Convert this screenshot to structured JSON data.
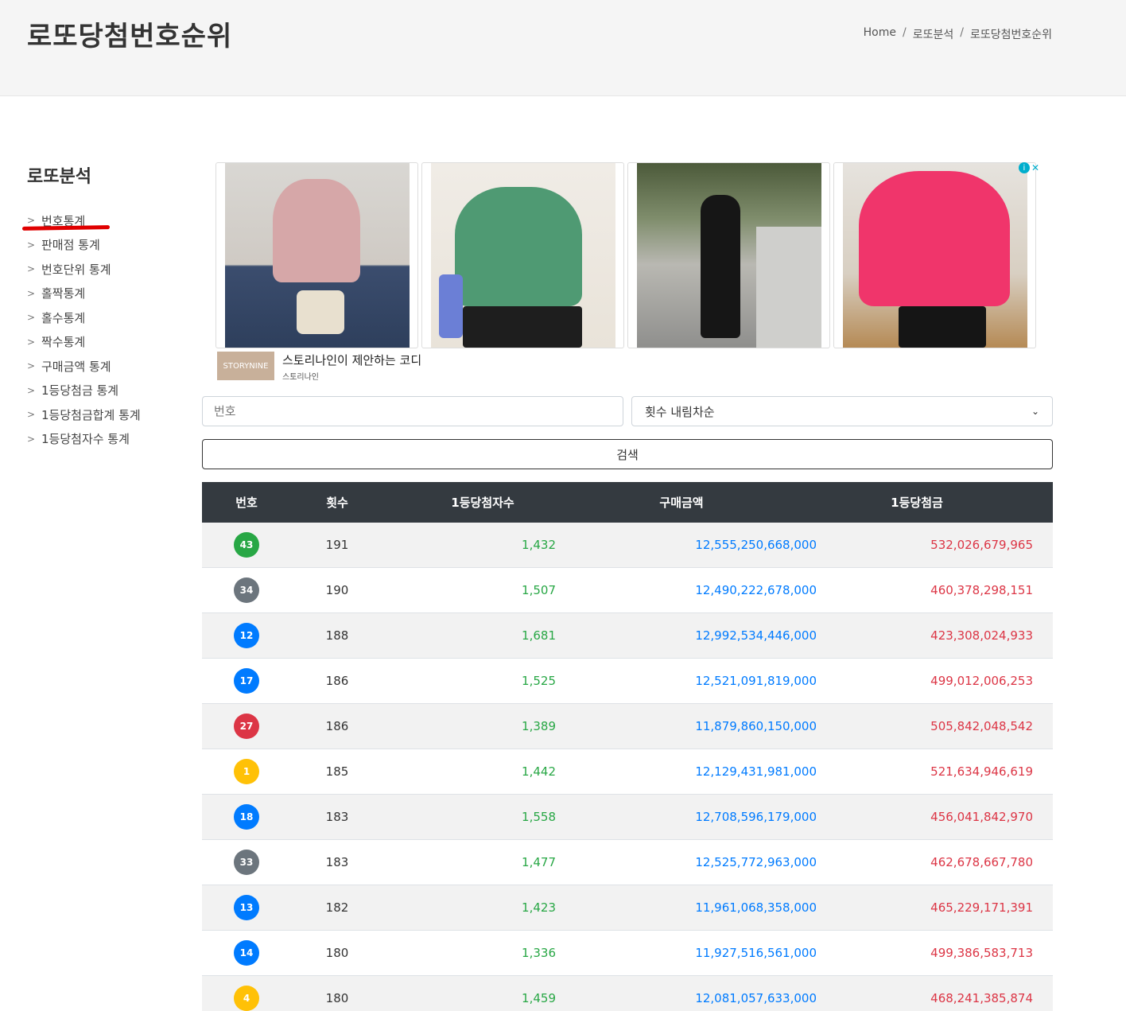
{
  "header": {
    "title": "로또당첨번호순위",
    "breadcrumb": [
      "Home",
      "로또분석",
      "로또당첨번호순위"
    ]
  },
  "sidebar": {
    "title": "로또분석",
    "items": [
      {
        "label": "번호통계",
        "active": true
      },
      {
        "label": "판매점 통계"
      },
      {
        "label": "번호단위 통계"
      },
      {
        "label": "홀짝통계"
      },
      {
        "label": "홀수통계"
      },
      {
        "label": "짝수통계"
      },
      {
        "label": "구매금액 통계"
      },
      {
        "label": "1등당첨금 통계"
      },
      {
        "label": "1등당첨금합계 통계"
      },
      {
        "label": "1등당첨자수 통계"
      }
    ]
  },
  "ad": {
    "title": "스토리나인이 제안하는 코디",
    "advertiser": "스토리나인",
    "logo_text": "STORYNINE"
  },
  "search": {
    "placeholder": "번호",
    "sort_value": "횟수 내림차순",
    "button": "검색"
  },
  "table": {
    "headers": [
      "번호",
      "횟수",
      "1등당첨자수",
      "구매금액",
      "1등당첨금"
    ],
    "rows": [
      {
        "num": "43",
        "color": "#28a745",
        "count": "191",
        "winners": "1,432",
        "purchase": "12,555,250,668,000",
        "prize": "532,026,679,965"
      },
      {
        "num": "34",
        "color": "#6c757d",
        "count": "190",
        "winners": "1,507",
        "purchase": "12,490,222,678,000",
        "prize": "460,378,298,151"
      },
      {
        "num": "12",
        "color": "#007bff",
        "count": "188",
        "winners": "1,681",
        "purchase": "12,992,534,446,000",
        "prize": "423,308,024,933"
      },
      {
        "num": "17",
        "color": "#007bff",
        "count": "186",
        "winners": "1,525",
        "purchase": "12,521,091,819,000",
        "prize": "499,012,006,253"
      },
      {
        "num": "27",
        "color": "#dc3545",
        "count": "186",
        "winners": "1,389",
        "purchase": "11,879,860,150,000",
        "prize": "505,842,048,542"
      },
      {
        "num": "1",
        "color": "#ffc107",
        "count": "185",
        "winners": "1,442",
        "purchase": "12,129,431,981,000",
        "prize": "521,634,946,619"
      },
      {
        "num": "18",
        "color": "#007bff",
        "count": "183",
        "winners": "1,558",
        "purchase": "12,708,596,179,000",
        "prize": "456,041,842,970"
      },
      {
        "num": "33",
        "color": "#6c757d",
        "count": "183",
        "winners": "1,477",
        "purchase": "12,525,772,963,000",
        "prize": "462,678,667,780"
      },
      {
        "num": "13",
        "color": "#007bff",
        "count": "182",
        "winners": "1,423",
        "purchase": "11,961,068,358,000",
        "prize": "465,229,171,391"
      },
      {
        "num": "14",
        "color": "#007bff",
        "count": "180",
        "winners": "1,336",
        "purchase": "11,927,516,561,000",
        "prize": "499,386,583,713"
      },
      {
        "num": "4",
        "color": "#ffc107",
        "count": "180",
        "winners": "1,459",
        "purchase": "12,081,057,633,000",
        "prize": "468,241,385,874"
      }
    ]
  }
}
